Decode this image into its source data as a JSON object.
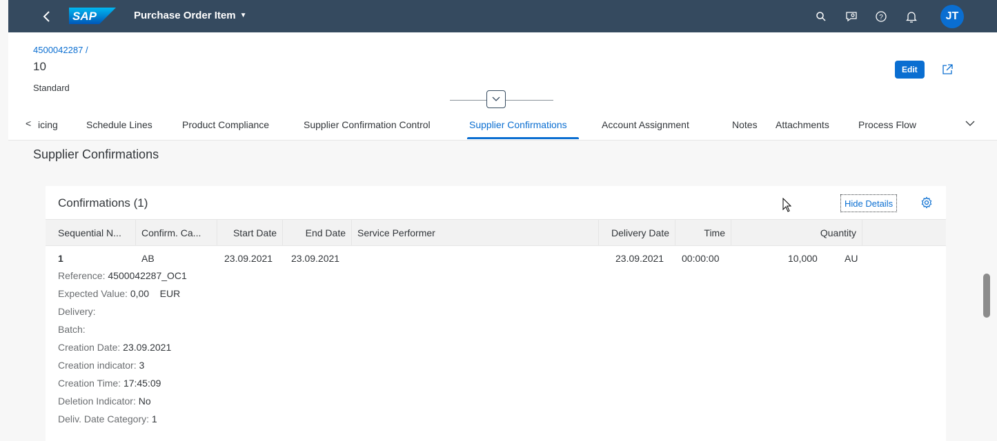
{
  "shell": {
    "app_title": "Purchase Order Item",
    "logo_text": "SAP",
    "avatar_initials": "JT",
    "icons": [
      "back-icon",
      "search-icon",
      "feedback-icon",
      "help-icon",
      "notification-icon"
    ],
    "brand_color": "#354a5f",
    "accent_color": "#0a6ed1"
  },
  "header": {
    "breadcrumb_link": "4500042287",
    "breadcrumb_sep": "/",
    "title": "10",
    "subtitle": "Standard",
    "edit_label": "Edit"
  },
  "tabs": {
    "items": [
      {
        "label": "icing"
      },
      {
        "label": "Schedule Lines"
      },
      {
        "label": "Product Compliance"
      },
      {
        "label": "Supplier Confirmation Control"
      },
      {
        "label": "Supplier Confirmations"
      },
      {
        "label": "Account Assignment"
      },
      {
        "label": "Notes"
      },
      {
        "label": "Attachments"
      },
      {
        "label": "Process Flow"
      }
    ],
    "active": "Supplier Confirmations"
  },
  "section": {
    "title": "Supplier Confirmations"
  },
  "table": {
    "title": "Confirmations (1)",
    "hide_details_label": "Hide Details",
    "columns": [
      "Sequential N...",
      "Confirm. Ca...",
      "Start Date",
      "End Date",
      "Service Performer",
      "Delivery Date",
      "Time",
      "Quantity"
    ],
    "row": {
      "seq": "1",
      "category": "AB",
      "start_date": "23.09.2021",
      "end_date": "23.09.2021",
      "service_performer": "",
      "delivery_date": "23.09.2021",
      "time": "00:00:00",
      "quantity": "10,000",
      "unit": "AU"
    },
    "details": [
      {
        "label": "Reference:",
        "value": "4500042287_OC1"
      },
      {
        "label": "Expected Value:",
        "value": "0,00",
        "extra": "EUR"
      },
      {
        "label": "Delivery:",
        "value": ""
      },
      {
        "label": "Batch:",
        "value": ""
      },
      {
        "label": "Creation Date:",
        "value": "23.09.2021"
      },
      {
        "label": "Creation indicator:",
        "value": "3"
      },
      {
        "label": "Creation Time:",
        "value": "17:45:09"
      },
      {
        "label": "Deletion Indicator:",
        "value": "No"
      },
      {
        "label": "Deliv. Date Category:",
        "value": "1"
      }
    ]
  }
}
